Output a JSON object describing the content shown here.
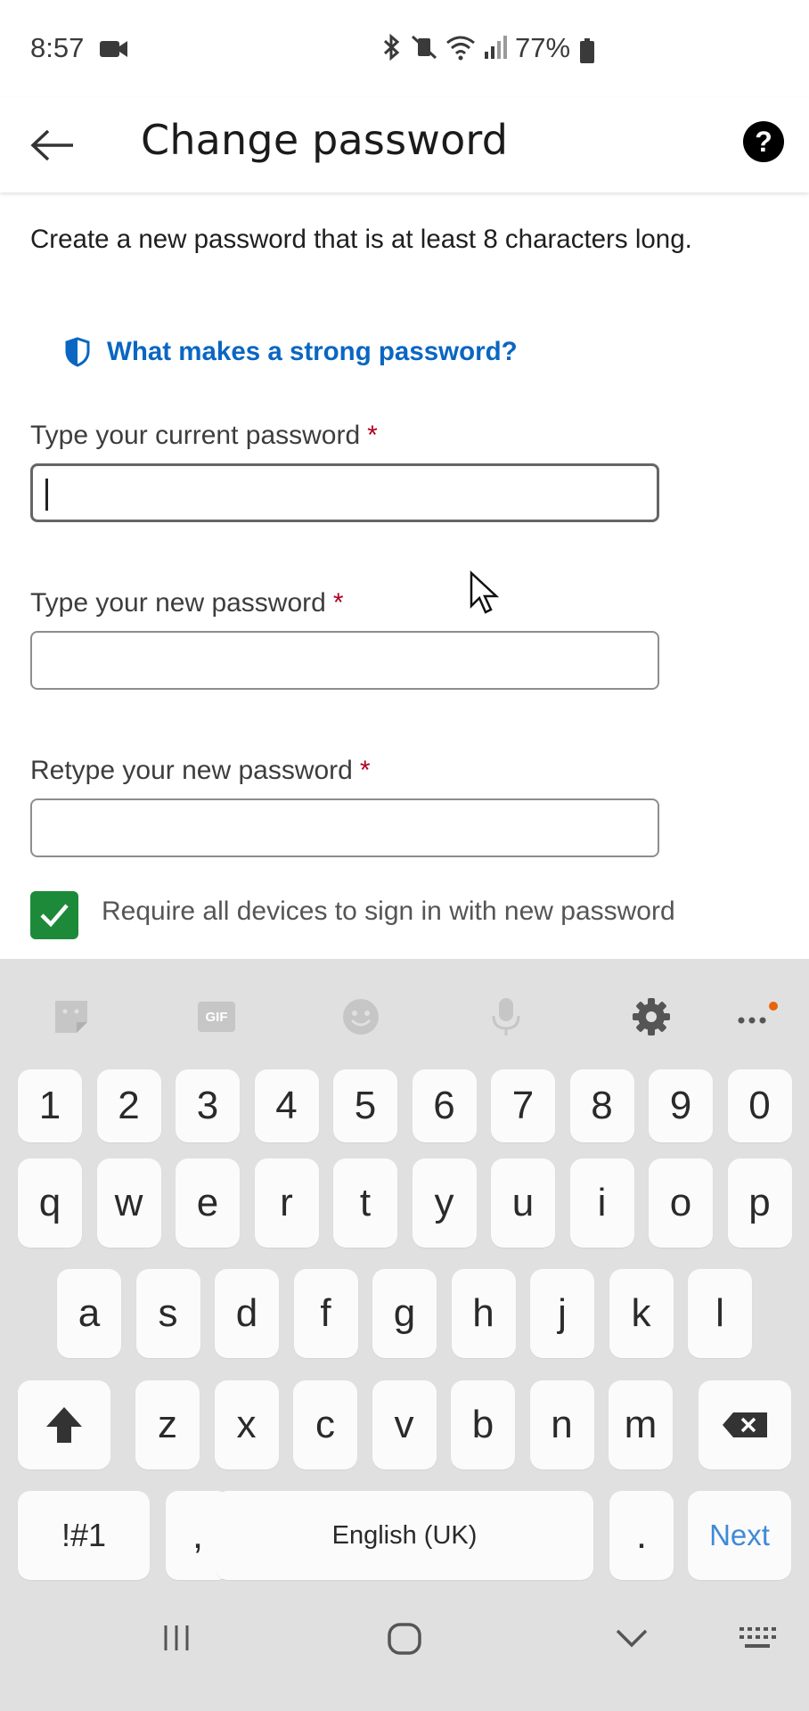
{
  "status_bar": {
    "time": "8:57",
    "battery": "77%"
  },
  "app_bar": {
    "title": "Change password",
    "help_icon": "?"
  },
  "intro_text": "Create a new password that is at least 8 characters long.",
  "strong_link": "What makes a strong password?",
  "fields": [
    {
      "label": "Type your current password",
      "required": "*",
      "value": ""
    },
    {
      "label": "Type your new password",
      "required": "*",
      "value": ""
    },
    {
      "label": "Retype your new password",
      "required": "*",
      "value": ""
    }
  ],
  "checkbox": {
    "label": "Require all devices to sign in with new password",
    "checked": true
  },
  "keyboard": {
    "toolbar": [
      "sticker-icon",
      "gif-icon",
      "emoji-icon",
      "mic-icon",
      "settings-icon",
      "more-icon"
    ],
    "gif_label": "GIF",
    "row_numbers": [
      "1",
      "2",
      "3",
      "4",
      "5",
      "6",
      "7",
      "8",
      "9",
      "0"
    ],
    "row_q": [
      "q",
      "w",
      "e",
      "r",
      "t",
      "y",
      "u",
      "i",
      "o",
      "p"
    ],
    "row_a": [
      "a",
      "s",
      "d",
      "f",
      "g",
      "h",
      "j",
      "k",
      "l"
    ],
    "row_z": [
      "z",
      "x",
      "c",
      "v",
      "b",
      "n",
      "m"
    ],
    "symbols_key": "!#1",
    "comma_key": ",",
    "space_key": "English (UK)",
    "period_key": ".",
    "next_key": "Next"
  },
  "colors": {
    "accent": "#0a66c2",
    "check": "#1d8a3a",
    "required": "#b00020",
    "keyboard_bg": "#e0e0e0"
  }
}
